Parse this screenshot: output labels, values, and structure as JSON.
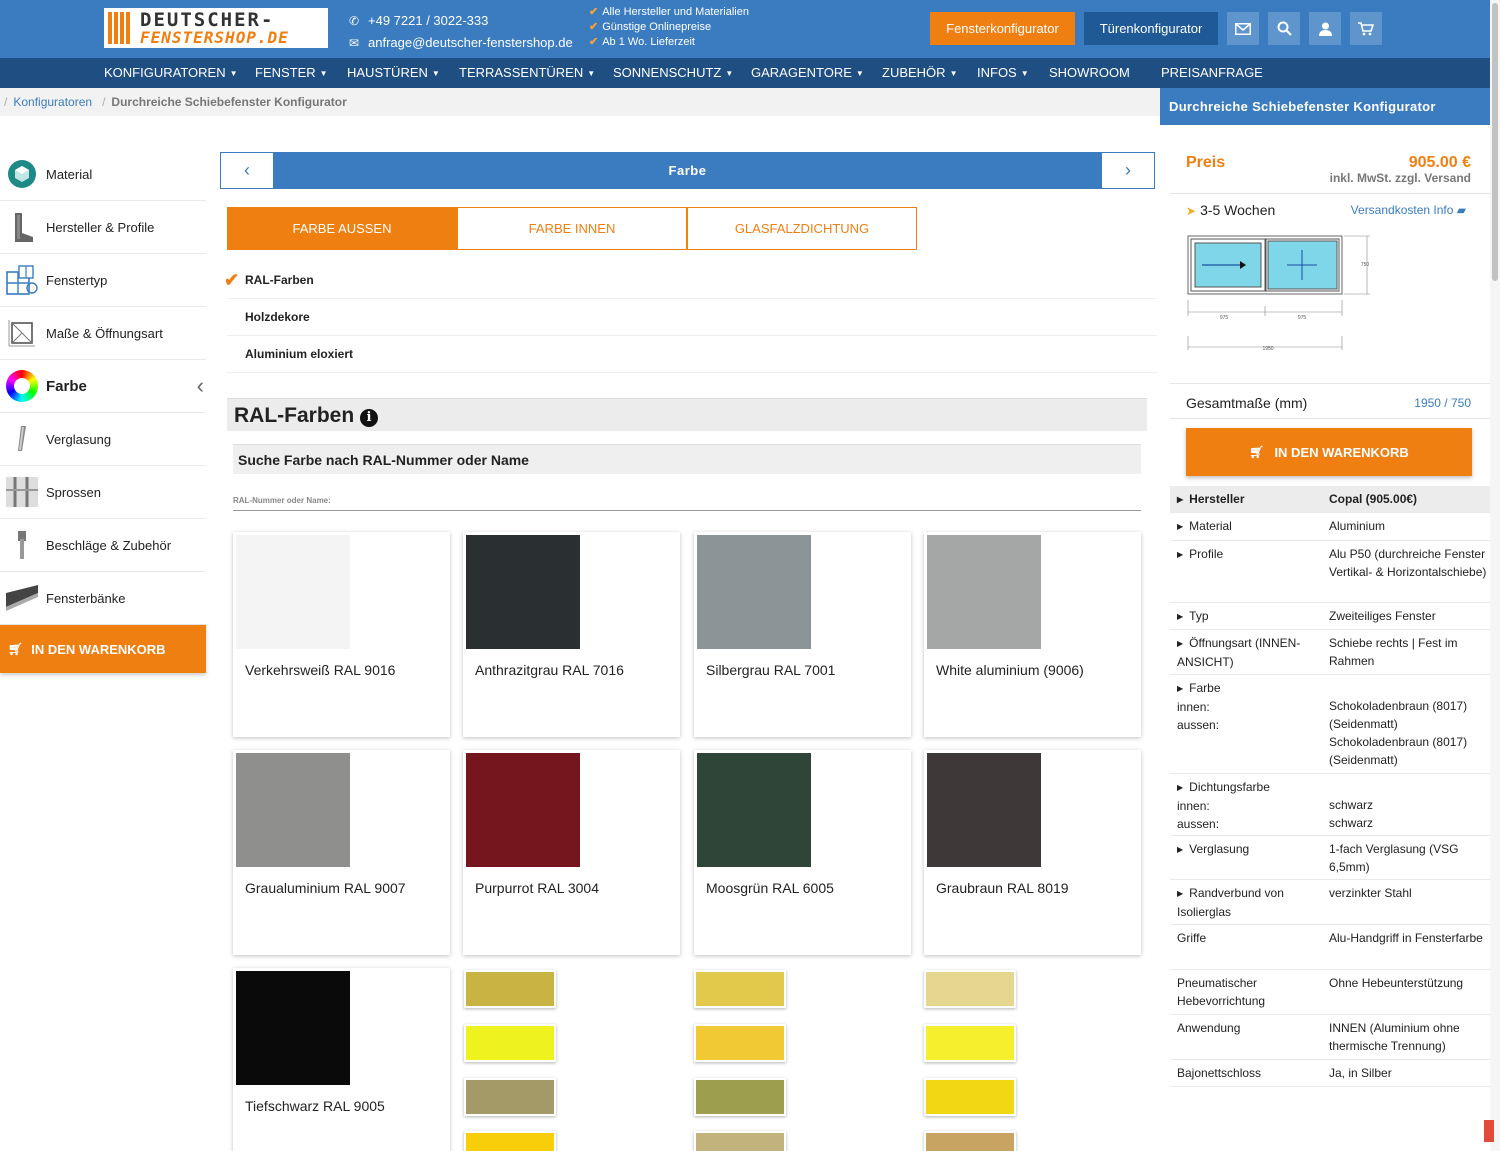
{
  "header": {
    "logo_line1": "DEUTSCHER-",
    "logo_line2": "FENSTERSHOP.DE",
    "phone": "+49 7221 / 3022-333",
    "email": "anfrage@deutscher-fenstershop.de",
    "usps": [
      "Alle Hersteller und Materialien",
      "Günstige Onlinepreise",
      "Ab 1 Wo. Lieferzeit"
    ],
    "btn_fenster": "Fensterkonfigurator",
    "btn_tueren": "Türenkonfigurator",
    "icons": [
      "mail-icon",
      "search-icon",
      "user-icon",
      "cart-icon"
    ]
  },
  "nav": {
    "items": [
      "KONFIGURATOREN",
      "FENSTER",
      "HAUSTÜREN",
      "TERRASSENTÜREN",
      "SONNENSCHUTZ",
      "GARAGENTORE",
      "ZUBEHÖR",
      "INFOS",
      "SHOWROOM",
      "PREISANFRAGE"
    ]
  },
  "breadcrumb": {
    "link": "Konfiguratoren",
    "current": "Durchreiche Schiebefenster Konfigurator"
  },
  "steps": [
    {
      "label": "Material"
    },
    {
      "label": "Hersteller & Profile"
    },
    {
      "label": "Fenstertyp"
    },
    {
      "label": "Maße & Öffnungsart"
    },
    {
      "label": "Farbe",
      "active": true
    },
    {
      "label": "Verglasung"
    },
    {
      "label": "Sprossen"
    },
    {
      "label": "Beschläge & Zubehör"
    },
    {
      "label": "Fensterbänke"
    }
  ],
  "cart_label": "IN DEN WARENKORB",
  "stepbar": {
    "title": "Farbe"
  },
  "tabs": [
    "FARBE AUSSEN",
    "FARBE INNEN",
    "GLASFALZDICHTUNG"
  ],
  "color_types": [
    "RAL-Farben",
    "Holzdekore",
    "Aluminium eloxiert"
  ],
  "section": {
    "title": "RAL-Farben",
    "search_title": "Suche Farbe nach RAL-Nummer oder Name",
    "search_label": "RAL-Nummer oder Name:"
  },
  "colors": [
    {
      "name": "Verkehrsweiß RAL 9016",
      "hex": "#f4f4f4"
    },
    {
      "name": "Anthrazitgrau RAL 7016",
      "hex": "#2a2f31"
    },
    {
      "name": "Silbergrau RAL 7001",
      "hex": "#8b9497"
    },
    {
      "name": "White aluminium (9006)",
      "hex": "#a5a6a6"
    },
    {
      "name": "Graualuminium RAL 9007",
      "hex": "#8f8f8e"
    },
    {
      "name": "Purpurrot RAL 3004",
      "hex": "#75151e"
    },
    {
      "name": "Moosgrün RAL 6005",
      "hex": "#2f4538"
    },
    {
      "name": "Graubraun RAL 8019",
      "hex": "#3e3838"
    },
    {
      "name": "Tiefschwarz RAL 9005",
      "hex": "#0a0a0a"
    }
  ],
  "mini_swatches": [
    [
      "#c9b443",
      "#e2c94b",
      "#e5d690"
    ],
    [
      "#eef31f",
      "#f0c934",
      "#f5ef2e"
    ],
    [
      "#a49a68",
      "#9e9e4f",
      "#f2d714"
    ],
    [
      "#f8cd0a",
      "#c2b27b",
      "#c8a463"
    ]
  ],
  "sidebar": {
    "title": "Durchreiche Schiebefenster Konfigurator",
    "price_label": "Preis",
    "price": "905.00 €",
    "tax_note": "inkl. MwSt. zzgl. Versand",
    "delivery": "3-5 Wochen",
    "shipping_info": "Versandkosten Info",
    "drawing_dims": {
      "left": "975",
      "right": "975",
      "total": "1950",
      "height": "750"
    },
    "dims_label": "Gesamtmaße (mm)",
    "dims_value": "1950 / 750"
  },
  "specs": [
    {
      "k": "Hersteller",
      "v": "Copal (905.00€)",
      "arrow": true,
      "hl": true
    },
    {
      "k": "Material",
      "v": "Aluminium",
      "arrow": true
    },
    {
      "k": "Profile",
      "v": "Alu P50 (durchreiche Fenster Vertikal- & Horizontalschiebe)",
      "arrow": true
    },
    {
      "k": "Typ",
      "v": "Zweiteiliges Fenster",
      "arrow": true
    },
    {
      "k": "Öffnungsart (INNEN-ANSICHT)",
      "v": "Schiebe rechts | Fest im Rahmen",
      "arrow": true
    },
    {
      "k": "Farbe\ninnen:\naussen:",
      "v": "\nSchokoladenbraun (8017) (Seidenmatt)\nSchokoladenbraun (8017) (Seidenmatt)",
      "arrow": true
    },
    {
      "k": "Dichtungsfarbe\ninnen:\naussen:",
      "v": "\nschwarz\nschwarz",
      "arrow": true
    },
    {
      "k": "Verglasung",
      "v": "1-fach Verglasung (VSG 6,5mm)",
      "arrow": true
    },
    {
      "k": "Randverbund von Isolierglas",
      "v": "verzinkter Stahl",
      "arrow": true
    },
    {
      "k": "Griffe",
      "v": "Alu-Handgriff in Fensterfarbe"
    },
    {
      "k": "Pneumatischer Hebevorrichtung",
      "v": "Ohne Hebeunterstützung"
    },
    {
      "k": "Anwendung",
      "v": "INNEN (Aluminium ohne thermische Trennung)"
    },
    {
      "k": "Bajonettschloss",
      "v": "Ja, in Silber"
    }
  ]
}
